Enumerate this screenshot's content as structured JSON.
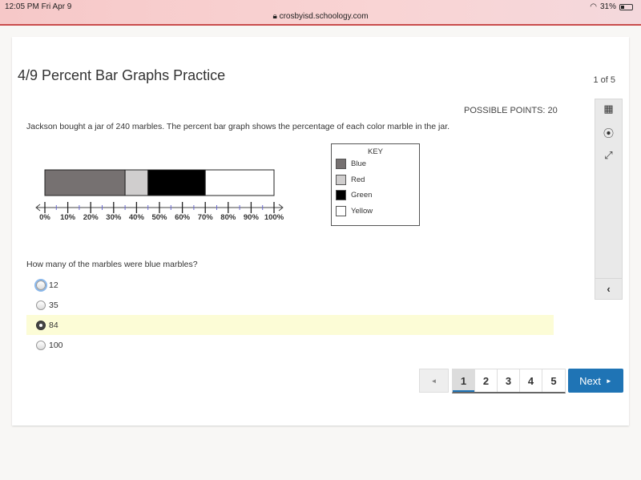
{
  "status_bar": {
    "time": "12:05 PM  Fri Apr 9",
    "url": "crosbyisd.schoology.com",
    "battery": "31%"
  },
  "header": {
    "title": "4/9 Percent Bar Graphs Practice",
    "page_of": "1 of 5"
  },
  "question": {
    "points": "POSSIBLE POINTS: 20",
    "text": "Jackson bought a jar of 240 marbles. The percent bar graph shows the percentage of each color marble in the jar.",
    "prompt": "How many of the marbles were blue marbles?",
    "options": [
      {
        "label": "12",
        "selected": false,
        "focused": true
      },
      {
        "label": "35",
        "selected": false
      },
      {
        "label": "84",
        "selected": true
      },
      {
        "label": "100",
        "selected": false
      }
    ]
  },
  "chart_data": {
    "type": "bar",
    "title": "",
    "segments": [
      {
        "name": "Blue",
        "start": 0,
        "end": 35,
        "color": "#767171"
      },
      {
        "name": "Red",
        "start": 35,
        "end": 45,
        "color": "#d0cece"
      },
      {
        "name": "Green",
        "start": 45,
        "end": 70,
        "color": "#000000"
      },
      {
        "name": "Yellow",
        "start": 70,
        "end": 100,
        "color": "#ffffff"
      }
    ],
    "tick_labels": [
      "0%",
      "10%",
      "20%",
      "30%",
      "40%",
      "50%",
      "60%",
      "70%",
      "80%",
      "90%",
      "100%"
    ],
    "xlim": [
      0,
      100
    ],
    "legend": {
      "title": "KEY",
      "placement": "right"
    }
  },
  "toolbar": {
    "icons": [
      "calendar-icon",
      "accessibility-icon",
      "expand-icon",
      "chevron-left-icon"
    ]
  },
  "pager": {
    "prev": "◄",
    "pages": [
      "1",
      "2",
      "3",
      "4",
      "5"
    ],
    "current": "1",
    "next": "Next",
    "next_arrow": "►"
  }
}
